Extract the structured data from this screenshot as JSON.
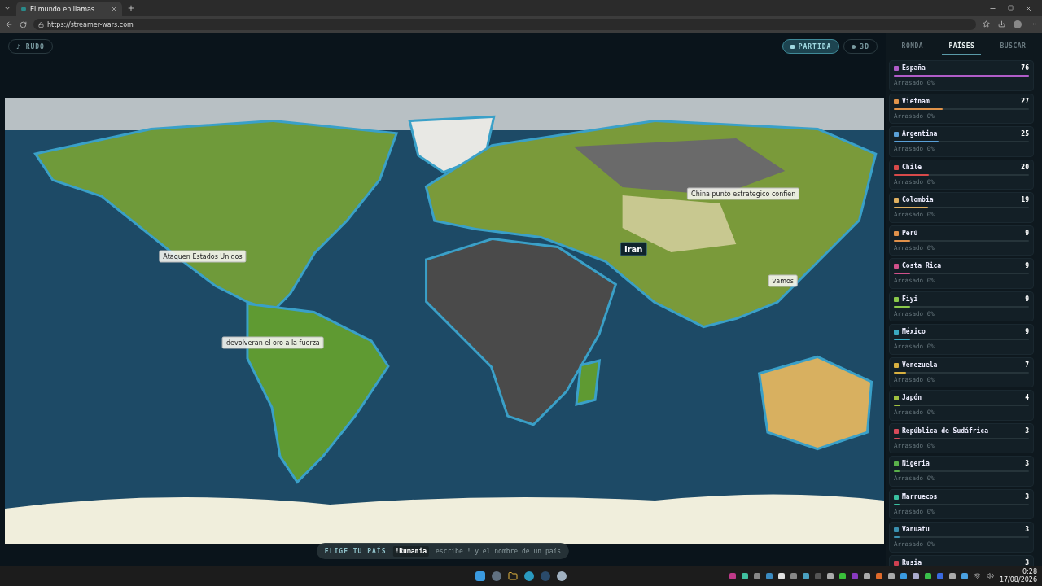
{
  "browser": {
    "tab_title": "El mundo en llamas",
    "url": "https://streamer-wars.com"
  },
  "toolbar": {
    "mode_button": "♪ RUDO",
    "view_buttons": [
      {
        "label": "PARTIDA",
        "selected": true
      },
      {
        "label": "3D",
        "selected": false
      }
    ]
  },
  "map_labels": [
    {
      "kind": "tag",
      "text": "China punto estrategico confien"
    },
    {
      "kind": "highlight",
      "text": "Iran"
    },
    {
      "kind": "tag",
      "text": "Ataquen Estados Unidos"
    },
    {
      "kind": "tag",
      "text": "vamos"
    },
    {
      "kind": "tag",
      "text": "devolveran el oro a la fuerza"
    }
  ],
  "command_bar": {
    "label": "ELIGE TU PAÍS",
    "command": "!Rumania",
    "hint": "escribe ! y el nombre de un país"
  },
  "sidebar": {
    "tabs": [
      {
        "label": "RONDA",
        "selected": false
      },
      {
        "label": "PAÍSES",
        "selected": true
      },
      {
        "label": "BUSCAR",
        "selected": false
      }
    ],
    "countries": [
      {
        "name": "España",
        "count": "76",
        "status": "Arrasado 0%",
        "color": "#b05cc8",
        "level": 1
      },
      {
        "name": "Vietnam",
        "count": "27",
        "status": "Arrasado 0%",
        "color": "#e0934a",
        "level": 0.36
      },
      {
        "name": "Argentina",
        "count": "25",
        "status": "Arrasado 0%",
        "color": "#5aa0d8",
        "level": 0.33
      },
      {
        "name": "Chile",
        "count": "20",
        "status": "Arrasado 0%",
        "color": "#d84a4a",
        "level": 0.26
      },
      {
        "name": "Colombia",
        "count": "19",
        "status": "Arrasado 0%",
        "color": "#e0b060",
        "level": 0.25
      },
      {
        "name": "Perú",
        "count": "9",
        "status": "Arrasado 0%",
        "color": "#e0904a",
        "level": 0.12
      },
      {
        "name": "Costa Rica",
        "count": "9",
        "status": "Arrasado 0%",
        "color": "#d0508a",
        "level": 0.12
      },
      {
        "name": "Fiyi",
        "count": "9",
        "status": "Arrasado 0%",
        "color": "#8ac84a",
        "level": 0.12
      },
      {
        "name": "México",
        "count": "9",
        "status": "Arrasado 0%",
        "color": "#3aa8c0",
        "level": 0.12
      },
      {
        "name": "Venezuela",
        "count": "7",
        "status": "Arrasado 0%",
        "color": "#d8b040",
        "level": 0.09
      },
      {
        "name": "Japón",
        "count": "4",
        "status": "Arrasado 0%",
        "color": "#a0c040",
        "level": 0.05
      },
      {
        "name": "República de Sudáfrica",
        "count": "3",
        "status": "Arrasado 0%",
        "color": "#d84a5a",
        "level": 0.04
      },
      {
        "name": "Nigeria",
        "count": "3",
        "status": "Arrasado 0%",
        "color": "#5ab04a",
        "level": 0.04
      },
      {
        "name": "Marruecos",
        "count": "3",
        "status": "Arrasado 0%",
        "color": "#3ac0a0",
        "level": 0.04
      },
      {
        "name": "Vanuatu",
        "count": "3",
        "status": "Arrasado 0%",
        "color": "#3a90b0",
        "level": 0.04
      },
      {
        "name": "Rusia",
        "count": "3",
        "color": "#d04050"
      }
    ]
  },
  "taskbar": {
    "time": "0:28",
    "date": "17/08/2026"
  }
}
